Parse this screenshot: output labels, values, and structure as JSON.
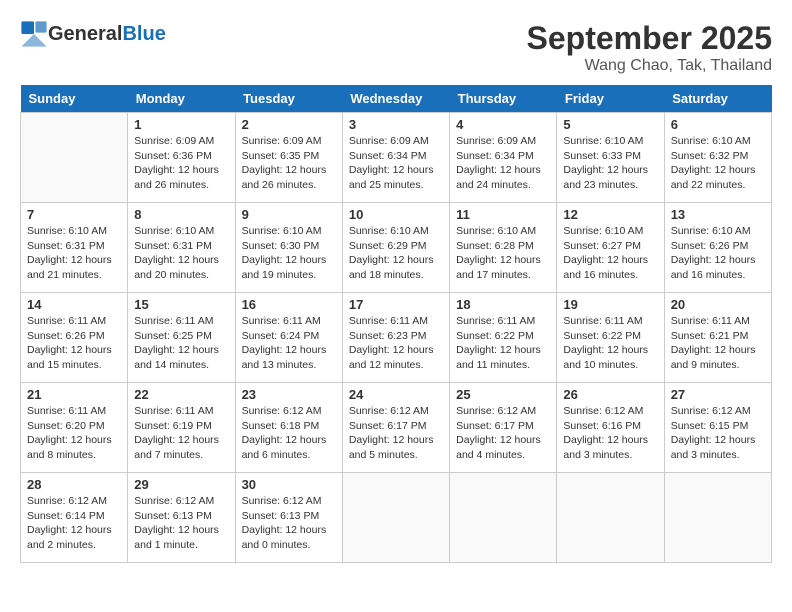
{
  "header": {
    "logo_general": "General",
    "logo_blue": "Blue",
    "month": "September 2025",
    "location": "Wang Chao, Tak, Thailand"
  },
  "weekdays": [
    "Sunday",
    "Monday",
    "Tuesday",
    "Wednesday",
    "Thursday",
    "Friday",
    "Saturday"
  ],
  "weeks": [
    [
      {
        "day": "",
        "info": ""
      },
      {
        "day": "1",
        "info": "Sunrise: 6:09 AM\nSunset: 6:36 PM\nDaylight: 12 hours and 26 minutes."
      },
      {
        "day": "2",
        "info": "Sunrise: 6:09 AM\nSunset: 6:35 PM\nDaylight: 12 hours and 26 minutes."
      },
      {
        "day": "3",
        "info": "Sunrise: 6:09 AM\nSunset: 6:34 PM\nDaylight: 12 hours and 25 minutes."
      },
      {
        "day": "4",
        "info": "Sunrise: 6:09 AM\nSunset: 6:34 PM\nDaylight: 12 hours and 24 minutes."
      },
      {
        "day": "5",
        "info": "Sunrise: 6:10 AM\nSunset: 6:33 PM\nDaylight: 12 hours and 23 minutes."
      },
      {
        "day": "6",
        "info": "Sunrise: 6:10 AM\nSunset: 6:32 PM\nDaylight: 12 hours and 22 minutes."
      }
    ],
    [
      {
        "day": "7",
        "info": "Sunrise: 6:10 AM\nSunset: 6:31 PM\nDaylight: 12 hours and 21 minutes."
      },
      {
        "day": "8",
        "info": "Sunrise: 6:10 AM\nSunset: 6:31 PM\nDaylight: 12 hours and 20 minutes."
      },
      {
        "day": "9",
        "info": "Sunrise: 6:10 AM\nSunset: 6:30 PM\nDaylight: 12 hours and 19 minutes."
      },
      {
        "day": "10",
        "info": "Sunrise: 6:10 AM\nSunset: 6:29 PM\nDaylight: 12 hours and 18 minutes."
      },
      {
        "day": "11",
        "info": "Sunrise: 6:10 AM\nSunset: 6:28 PM\nDaylight: 12 hours and 17 minutes."
      },
      {
        "day": "12",
        "info": "Sunrise: 6:10 AM\nSunset: 6:27 PM\nDaylight: 12 hours and 16 minutes."
      },
      {
        "day": "13",
        "info": "Sunrise: 6:10 AM\nSunset: 6:26 PM\nDaylight: 12 hours and 16 minutes."
      }
    ],
    [
      {
        "day": "14",
        "info": "Sunrise: 6:11 AM\nSunset: 6:26 PM\nDaylight: 12 hours and 15 minutes."
      },
      {
        "day": "15",
        "info": "Sunrise: 6:11 AM\nSunset: 6:25 PM\nDaylight: 12 hours and 14 minutes."
      },
      {
        "day": "16",
        "info": "Sunrise: 6:11 AM\nSunset: 6:24 PM\nDaylight: 12 hours and 13 minutes."
      },
      {
        "day": "17",
        "info": "Sunrise: 6:11 AM\nSunset: 6:23 PM\nDaylight: 12 hours and 12 minutes."
      },
      {
        "day": "18",
        "info": "Sunrise: 6:11 AM\nSunset: 6:22 PM\nDaylight: 12 hours and 11 minutes."
      },
      {
        "day": "19",
        "info": "Sunrise: 6:11 AM\nSunset: 6:22 PM\nDaylight: 12 hours and 10 minutes."
      },
      {
        "day": "20",
        "info": "Sunrise: 6:11 AM\nSunset: 6:21 PM\nDaylight: 12 hours and 9 minutes."
      }
    ],
    [
      {
        "day": "21",
        "info": "Sunrise: 6:11 AM\nSunset: 6:20 PM\nDaylight: 12 hours and 8 minutes."
      },
      {
        "day": "22",
        "info": "Sunrise: 6:11 AM\nSunset: 6:19 PM\nDaylight: 12 hours and 7 minutes."
      },
      {
        "day": "23",
        "info": "Sunrise: 6:12 AM\nSunset: 6:18 PM\nDaylight: 12 hours and 6 minutes."
      },
      {
        "day": "24",
        "info": "Sunrise: 6:12 AM\nSunset: 6:17 PM\nDaylight: 12 hours and 5 minutes."
      },
      {
        "day": "25",
        "info": "Sunrise: 6:12 AM\nSunset: 6:17 PM\nDaylight: 12 hours and 4 minutes."
      },
      {
        "day": "26",
        "info": "Sunrise: 6:12 AM\nSunset: 6:16 PM\nDaylight: 12 hours and 3 minutes."
      },
      {
        "day": "27",
        "info": "Sunrise: 6:12 AM\nSunset: 6:15 PM\nDaylight: 12 hours and 3 minutes."
      }
    ],
    [
      {
        "day": "28",
        "info": "Sunrise: 6:12 AM\nSunset: 6:14 PM\nDaylight: 12 hours and 2 minutes."
      },
      {
        "day": "29",
        "info": "Sunrise: 6:12 AM\nSunset: 6:13 PM\nDaylight: 12 hours and 1 minute."
      },
      {
        "day": "30",
        "info": "Sunrise: 6:12 AM\nSunset: 6:13 PM\nDaylight: 12 hours and 0 minutes."
      },
      {
        "day": "",
        "info": ""
      },
      {
        "day": "",
        "info": ""
      },
      {
        "day": "",
        "info": ""
      },
      {
        "day": "",
        "info": ""
      }
    ]
  ]
}
